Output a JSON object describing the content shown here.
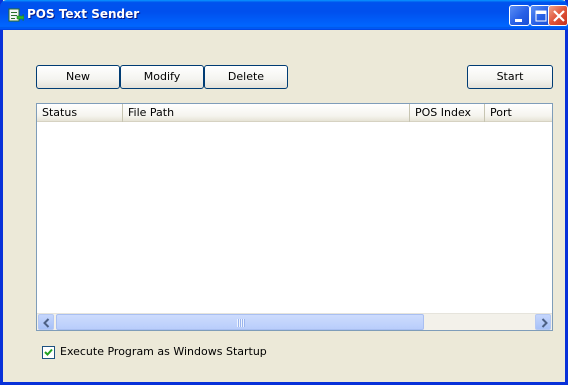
{
  "window": {
    "title": "POS Text Sender",
    "icon": "app-icon"
  },
  "titlebar_buttons": {
    "minimize": "minimize-icon",
    "maximize": "maximize-icon",
    "close": "close-icon"
  },
  "toolbar": {
    "new_label": "New",
    "modify_label": "Modify",
    "delete_label": "Delete",
    "start_label": "Start"
  },
  "list": {
    "columns": [
      "Status",
      "File Path",
      "POS Index",
      "Port"
    ],
    "rows": []
  },
  "options": {
    "startup_label": "Execute Program as Windows Startup",
    "startup_checked": true
  },
  "colors": {
    "titlebar": "#0054e3",
    "window_bg": "#ece9d8",
    "close_button": "#e0553a"
  }
}
